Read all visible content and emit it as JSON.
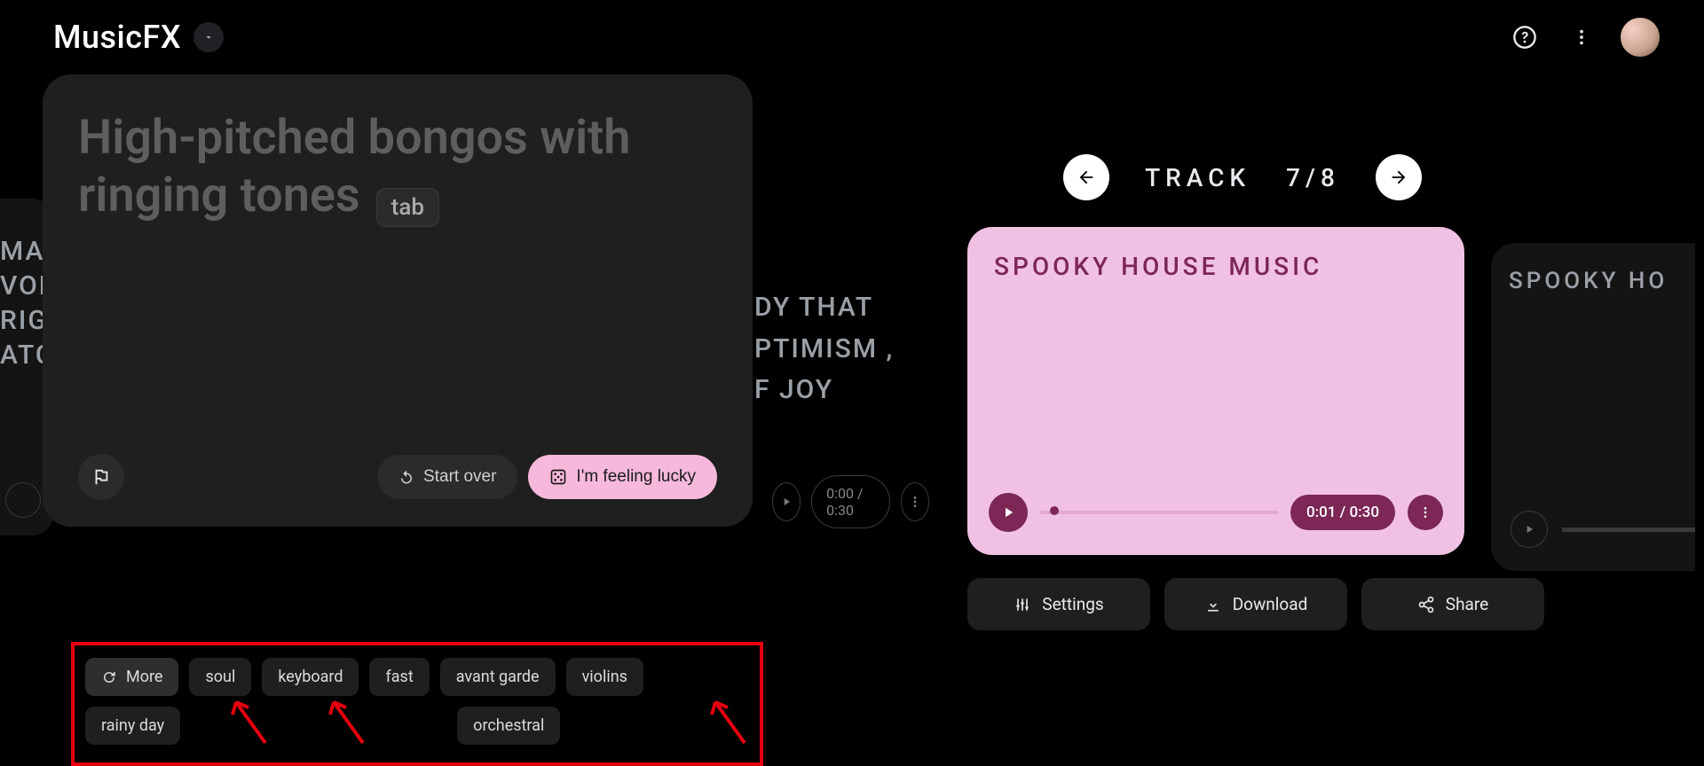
{
  "header": {
    "brand": "MusicFX"
  },
  "prompt": {
    "placeholder": "High-pitched bongos with ringing tones",
    "hint": "tab",
    "start_over": "Start over",
    "lucky": "I'm feeling lucky"
  },
  "ghost_left_lines": "MA\nVOK\nRIGH\nATC",
  "ghost_right_lines": "DY THAT\nPTIMISM ,\nF JOY",
  "ghost_right_time": "0:00 / 0:30",
  "chips": {
    "more": "More",
    "items": [
      "soul",
      "keyboard",
      "fast",
      "avant garde",
      "violins",
      "rainy day"
    ],
    "extra": "orchestral"
  },
  "track_nav": {
    "label": "TRACK",
    "index": "7/8"
  },
  "track": {
    "title": "SPOOKY HOUSE MUSIC",
    "time": "0:01 / 0:30",
    "next_title": "SPOOKY HO"
  },
  "actions": {
    "settings": "Settings",
    "download": "Download",
    "share": "Share"
  }
}
